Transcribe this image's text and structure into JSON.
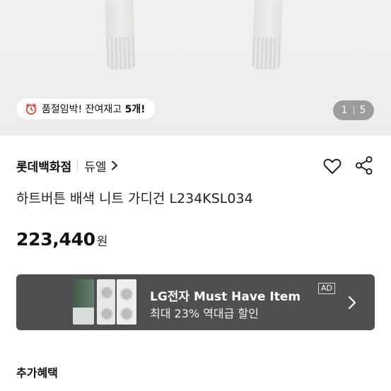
{
  "hero": {
    "stock_badge": {
      "icon": "alarm-clock-icon",
      "text": "품절임박! 잔여재고 ",
      "count": "5개!"
    },
    "pager": {
      "current": "1",
      "total": "5"
    }
  },
  "seller": {
    "name": "롯데백화점",
    "brand": "듀엘"
  },
  "actions": {
    "like_icon": "heart-icon",
    "share_icon": "share-icon"
  },
  "product": {
    "title": "하트버튼 배색 니트 가디건 L234KSL034",
    "price": "223,440",
    "price_unit": "원"
  },
  "ad": {
    "title": "LG전자 Must Have Item",
    "subtitle": "최대 23% 역대급 할인",
    "tag": "AD",
    "background": "#4f4f4f"
  },
  "benefits": {
    "heading": "추가혜택"
  }
}
